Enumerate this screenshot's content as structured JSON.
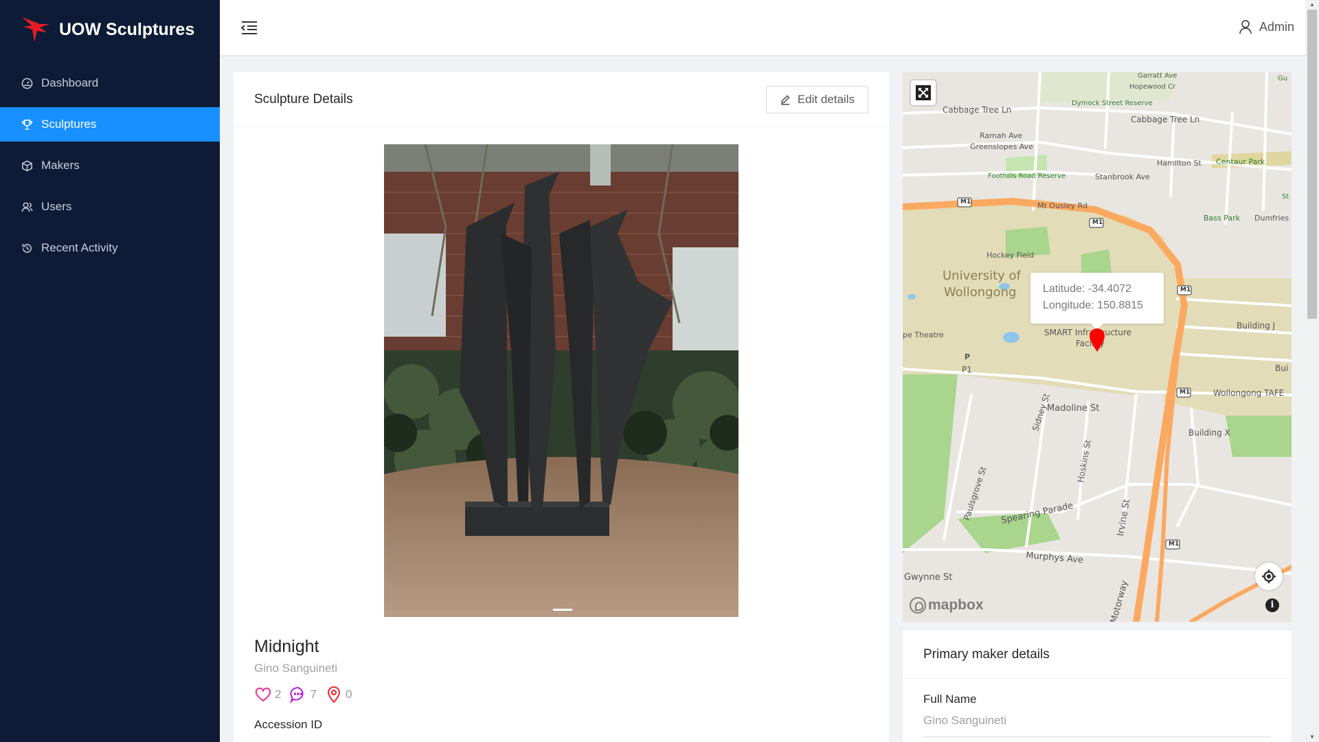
{
  "app": {
    "title": "UOW Sculptures",
    "brand_color": "#e61c24"
  },
  "sidebar": {
    "items": [
      {
        "label": "Dashboard",
        "icon": "dashboard-icon",
        "active": false
      },
      {
        "label": "Sculptures",
        "icon": "trophy-icon",
        "active": true
      },
      {
        "label": "Makers",
        "icon": "cube-icon",
        "active": false
      },
      {
        "label": "Users",
        "icon": "users-icon",
        "active": false
      },
      {
        "label": "Recent Activity",
        "icon": "history-icon",
        "active": false
      }
    ]
  },
  "header": {
    "user": "Admin"
  },
  "details": {
    "title": "Sculpture Details",
    "edit_label": "Edit details",
    "name": "Midnight",
    "maker": "Gino Sanguineti",
    "likes": "2",
    "comments": "7",
    "visits": "0",
    "accession_label": "Accession ID"
  },
  "map": {
    "popup_lat": "Latitude: -34.4072",
    "popup_lon": "Longitude: 150.8815",
    "attribution": "mapbox",
    "labels": {
      "garratt": "Garratt Ave",
      "hopewood": "Hopewood Cr",
      "dymock": "Dymock Street Reserve",
      "cabbage1": "Cabbage Tree Ln",
      "cabbage2": "Cabbage Tree Ln",
      "ramah": "Ramah Ave",
      "greenslopes": "Greenslopes Ave",
      "hamilton": "Hamilton St",
      "centaur": "Centaur Park",
      "foothills": "Foothills Road Reserve",
      "stanbrook": "Stanbrook Ave",
      "ousley": "Mt Ousley Rd",
      "bass": "Bass Park",
      "dumfries": "Dumfries",
      "hockey": "Hockey Field",
      "uni1": "University of",
      "uni2": "Wollongong",
      "theatre": "pe Theatre",
      "smart1": "SMART Infrastructure",
      "smart2": "Facility",
      "p1": "P1",
      "buildingj": "Building J",
      "tafe": "Wollongong TAFE",
      "bui": "Bui",
      "madoline": "Madoline St",
      "buildingx": "Building X",
      "sidney": "Sidney St",
      "hoskins": "Hoskins St",
      "paulsgrove": "Paulsgrove St",
      "spearing": "Spearing Parade",
      "irvine": "Irvine St",
      "murphys": "Murphys Ave",
      "gwynne": "Gwynne St",
      "motorway": "Motorway",
      "m1": "M1",
      "p": "P",
      "st": "St",
      "gu": "Gu"
    }
  },
  "maker_card": {
    "title": "Primary maker details",
    "full_name_label": "Full Name",
    "full_name": "Gino Sanguineti"
  }
}
